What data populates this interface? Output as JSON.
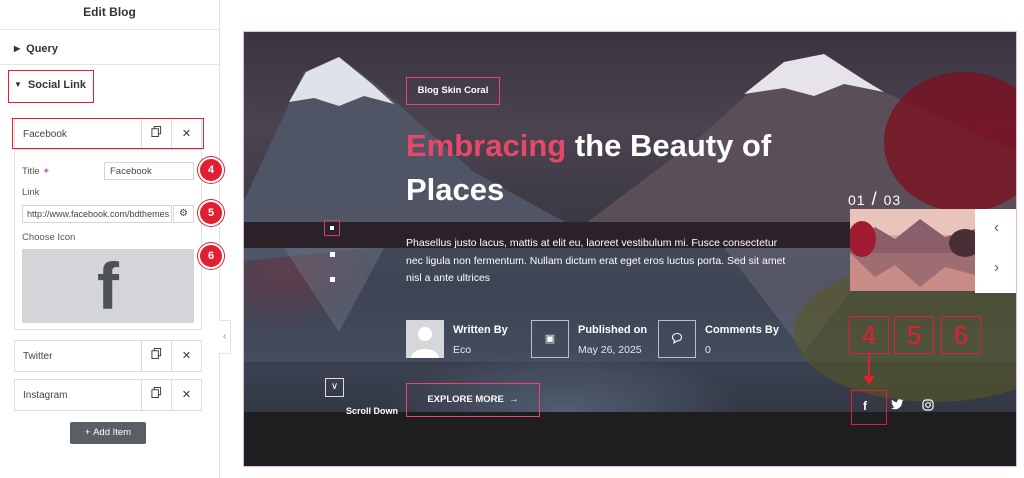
{
  "panel": {
    "title": "Edit Blog",
    "sections": {
      "query": "Query",
      "social_link": "Social Link"
    },
    "items": [
      {
        "label": "Facebook"
      },
      {
        "label": "Twitter"
      },
      {
        "label": "Instagram"
      }
    ],
    "facebook_fields": {
      "title_label": "Title",
      "title_value": "Facebook",
      "link_label": "Link",
      "link_value": "http://www.facebook.com/bdthemes",
      "icon_label": "Choose Icon",
      "icon_glyph": "f"
    },
    "badges": [
      "4",
      "5",
      "6"
    ],
    "add_item_label": "Add Item"
  },
  "preview": {
    "skin_tag": "Blog Skin Coral",
    "headline_accent": "Embracing",
    "headline_rest": " the Beauty of Places",
    "excerpt": "Phasellus justo lacus, mattis at elit eu, laoreet vestibulum mi. Fusce consectetur nec ligula non fermentum. Nullam dictum erat eget eros luctus porta. Sed sit amet nisl a ante ultrices",
    "meta": {
      "author_label": "Written By",
      "author_value": "Eco",
      "date_label": "Published on",
      "date_value": "May 26, 2025",
      "comments_label": "Comments By",
      "comments_value": "0"
    },
    "scroll_label": "Scroll Down",
    "explore_label": "EXPLORE MORE",
    "slide_current": "01",
    "slide_total": "03",
    "annotation_numbers": [
      "4",
      "5",
      "6"
    ],
    "accent_color": "#e8476a",
    "highlight_color": "#e02030"
  }
}
